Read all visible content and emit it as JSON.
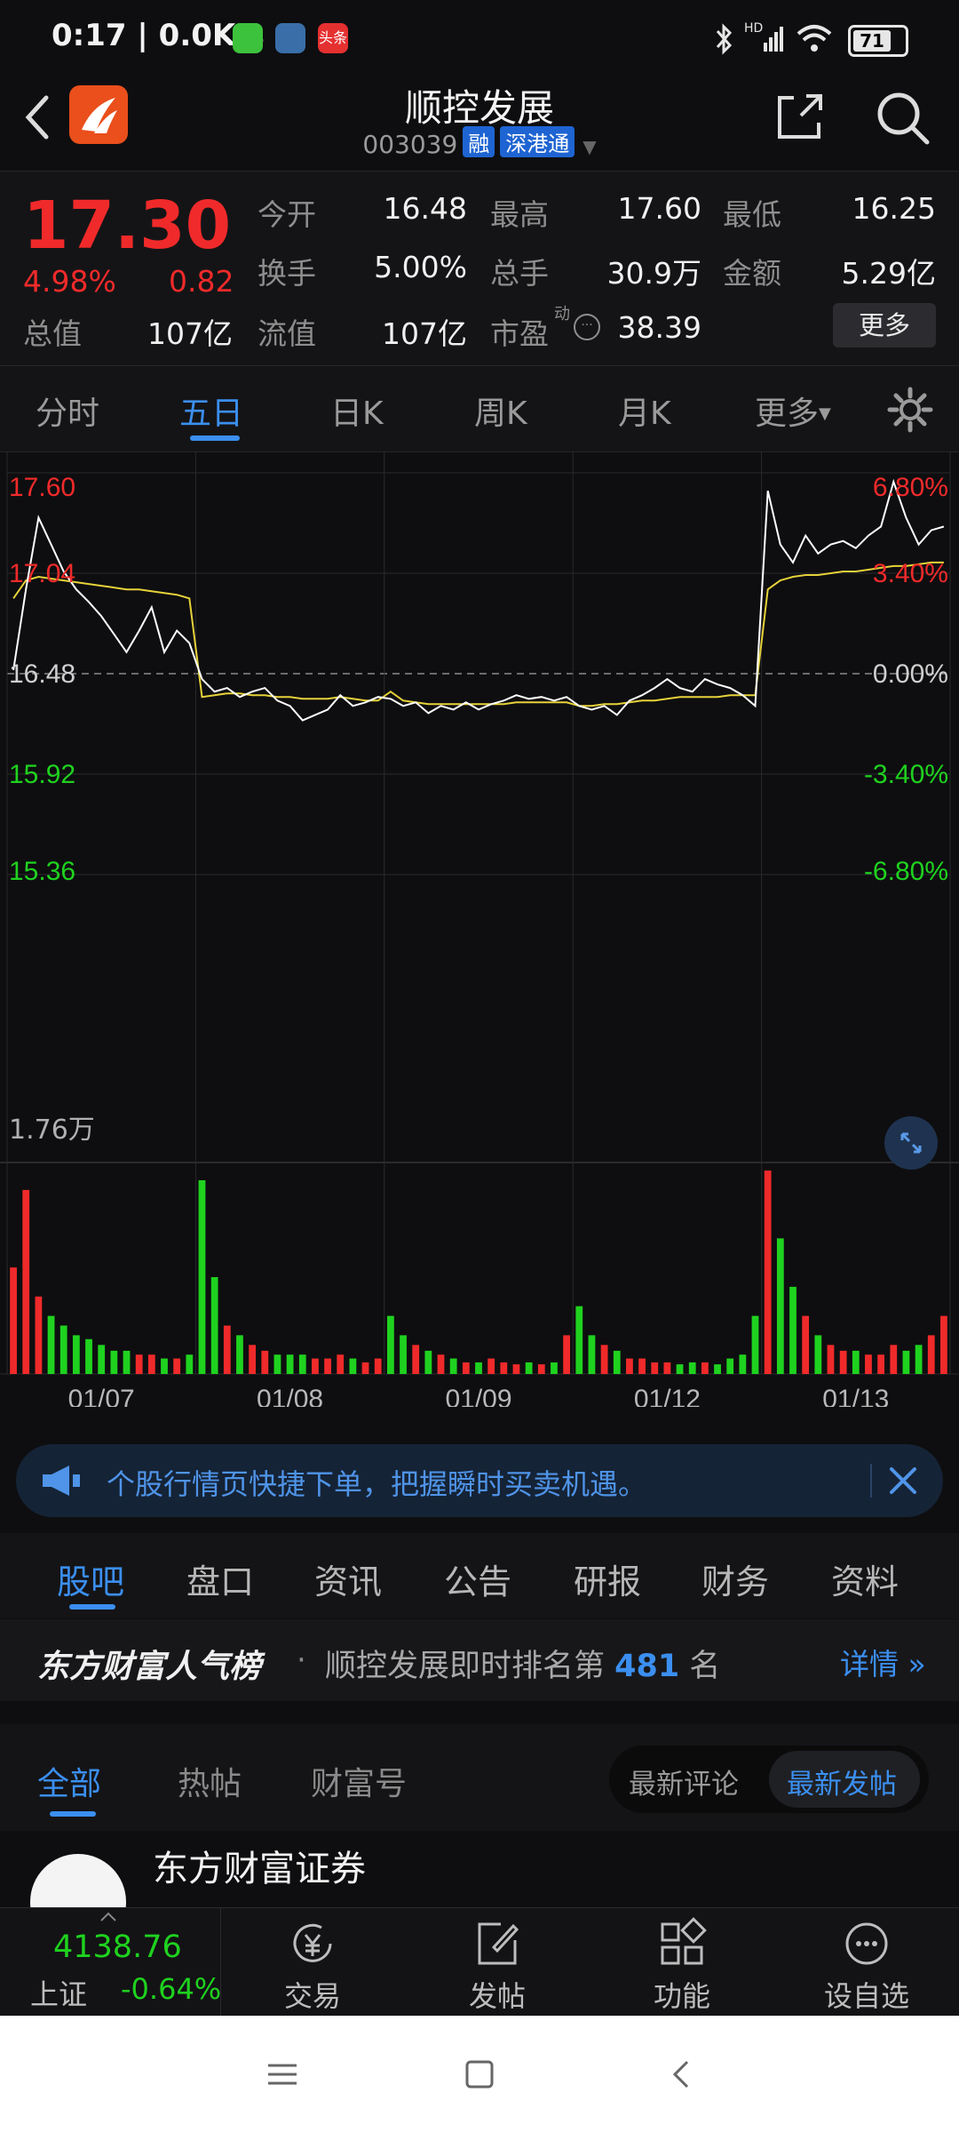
{
  "status": {
    "time": "0:17 | 0.0K/s",
    "app_badge": "头条",
    "battery": "71",
    "hd_label": "HD"
  },
  "header": {
    "title": "顺控发展",
    "code": "003039",
    "tags": [
      "融",
      "深港通"
    ]
  },
  "quote": {
    "price": "17.30",
    "change_pct": "4.98%",
    "change": "0.82",
    "total_cap_label": "总值",
    "total_cap": "107亿",
    "fields": [
      {
        "label": "今开",
        "value": "16.48"
      },
      {
        "label": "最高",
        "value": "17.60"
      },
      {
        "label": "最低",
        "value": "16.25"
      },
      {
        "label": "换手",
        "value": "5.00%"
      },
      {
        "label": "总手",
        "value": "30.9万"
      },
      {
        "label": "金额",
        "value": "5.29亿"
      },
      {
        "label": "流值",
        "value": "107亿"
      },
      {
        "label": "市盈",
        "value": "38.39"
      }
    ],
    "pe_superscript": "动",
    "more_button": "更多"
  },
  "tabs": [
    "分时",
    "五日",
    "日K",
    "周K",
    "月K",
    "更多"
  ],
  "colors": {
    "up": "#f02a2a",
    "down": "#1fd21f",
    "accent": "#3b8ff0",
    "price_line": "#ffffff",
    "avg_line": "#e6d23a"
  },
  "chart_data": {
    "type": "line",
    "y_left_ticks": [
      "17.60",
      "17.04",
      "16.48",
      "15.92",
      "15.36"
    ],
    "y_right_ticks": [
      "6.80%",
      "3.40%",
      "0.00%",
      "-3.40%",
      "-6.80%"
    ],
    "ylim": [
      15.36,
      17.6
    ],
    "base_price": 16.48,
    "volume_max_label": "1.76万",
    "x_labels": [
      "01/07",
      "01/08",
      "01/09",
      "01/12",
      "01/13"
    ],
    "series": [
      {
        "values": [
          16.5,
          16.95,
          17.35,
          17.2,
          17.05,
          16.95,
          16.88,
          16.8,
          16.7,
          16.6,
          16.72,
          16.85,
          16.6,
          16.72,
          16.65,
          16.45,
          16.38,
          16.4,
          16.35,
          16.38,
          16.4,
          16.33,
          16.3,
          16.22,
          16.25,
          16.28,
          16.36,
          16.3,
          16.32,
          16.35,
          16.34,
          16.3,
          16.32,
          16.26,
          16.3,
          16.28,
          16.32,
          16.28,
          16.31,
          16.33,
          16.36,
          16.34,
          16.35,
          16.33,
          16.35,
          16.3,
          16.28,
          16.3,
          16.25,
          16.33,
          16.36,
          16.4,
          16.45,
          16.4,
          16.38,
          16.45,
          16.42,
          16.4,
          16.36,
          16.3,
          17.5,
          17.2,
          17.1,
          17.25,
          17.15,
          17.2,
          17.22,
          17.18,
          17.25,
          17.3,
          17.55,
          17.35,
          17.2,
          17.28,
          17.3
        ]
      },
      {
        "values": [
          16.9,
          17.0,
          17.02,
          17.01,
          17.0,
          16.99,
          16.98,
          16.97,
          16.96,
          16.95,
          16.95,
          16.94,
          16.93,
          16.92,
          16.9,
          16.35,
          16.36,
          16.37,
          16.37,
          16.36,
          16.36,
          16.35,
          16.35,
          16.34,
          16.34,
          16.34,
          16.35,
          16.34,
          16.33,
          16.33,
          16.38,
          16.33,
          16.32,
          16.31,
          16.31,
          16.31,
          16.31,
          16.31,
          16.31,
          16.31,
          16.32,
          16.32,
          16.32,
          16.32,
          16.32,
          16.3,
          16.3,
          16.31,
          16.31,
          16.32,
          16.33,
          16.33,
          16.34,
          16.35,
          16.35,
          16.35,
          16.35,
          16.36,
          16.36,
          16.36,
          16.95,
          17.0,
          17.02,
          17.03,
          17.03,
          17.04,
          17.05,
          17.05,
          17.06,
          17.07,
          17.08,
          17.08,
          17.09,
          17.1,
          17.1
        ]
      }
    ],
    "volume": [
      0.55,
      0.95,
      0.4,
      0.3,
      0.25,
      0.2,
      0.18,
      0.15,
      0.12,
      0.12,
      0.1,
      0.1,
      0.08,
      0.08,
      0.1,
      1.0,
      0.5,
      0.25,
      0.2,
      0.15,
      0.12,
      0.1,
      0.1,
      0.1,
      0.08,
      0.08,
      0.1,
      0.08,
      0.06,
      0.08,
      0.3,
      0.2,
      0.15,
      0.12,
      0.1,
      0.08,
      0.06,
      0.06,
      0.08,
      0.06,
      0.05,
      0.06,
      0.05,
      0.06,
      0.2,
      0.35,
      0.2,
      0.15,
      0.12,
      0.08,
      0.08,
      0.06,
      0.06,
      0.05,
      0.06,
      0.06,
      0.05,
      0.08,
      0.1,
      0.3,
      1.05,
      0.7,
      0.45,
      0.3,
      0.2,
      0.15,
      0.12,
      0.12,
      0.1,
      0.1,
      0.15,
      0.12,
      0.15,
      0.2,
      0.3
    ]
  },
  "banner": {
    "text": "个股行情页快捷下单，把握瞬时买卖机遇。"
  },
  "subtabs": [
    "股吧",
    "盘口",
    "资讯",
    "公告",
    "研报",
    "财务",
    "资料"
  ],
  "rank": {
    "brand": "东方财富人气榜",
    "prefix": "顺控发展即时排名第",
    "number": "481",
    "suffix": "名",
    "link": "详情"
  },
  "filter": {
    "tabs": [
      "全部",
      "热帖",
      "财富号"
    ],
    "sort_options": [
      "最新评论",
      "最新发帖"
    ]
  },
  "post": {
    "author": "东方财富证券"
  },
  "bottombar": {
    "index_value": "4138.76",
    "index_name": "上证",
    "index_change": "-0.64%",
    "items": [
      "交易",
      "发帖",
      "功能",
      "设自选"
    ]
  }
}
